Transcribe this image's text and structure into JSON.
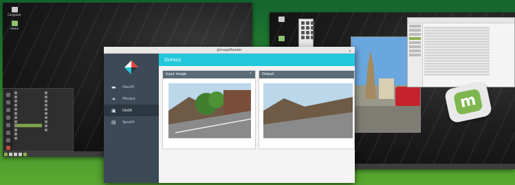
{
  "app": {
    "window_title": "gImageReader",
    "header_title": "Dotazy",
    "nav": [
      {
        "label": "Otevřít",
        "icon": "folder-icon"
      },
      {
        "label": "Převést",
        "icon": "arrow-right-icon"
      },
      {
        "label": "Uložit",
        "icon": "save-icon"
      },
      {
        "label": "Spustit",
        "icon": "play-icon"
      }
    ],
    "active_nav": 2,
    "panel_input_title": "Input image",
    "panel_output_title": "Output"
  },
  "desktop_icons": [
    {
      "label": "Computer"
    },
    {
      "label": "Home"
    }
  ],
  "colors": {
    "accent": "#21c7da",
    "nav_bg": "#3b4a56",
    "mint_green": "#7eb74f",
    "bg_green": "#2d8a2e"
  }
}
